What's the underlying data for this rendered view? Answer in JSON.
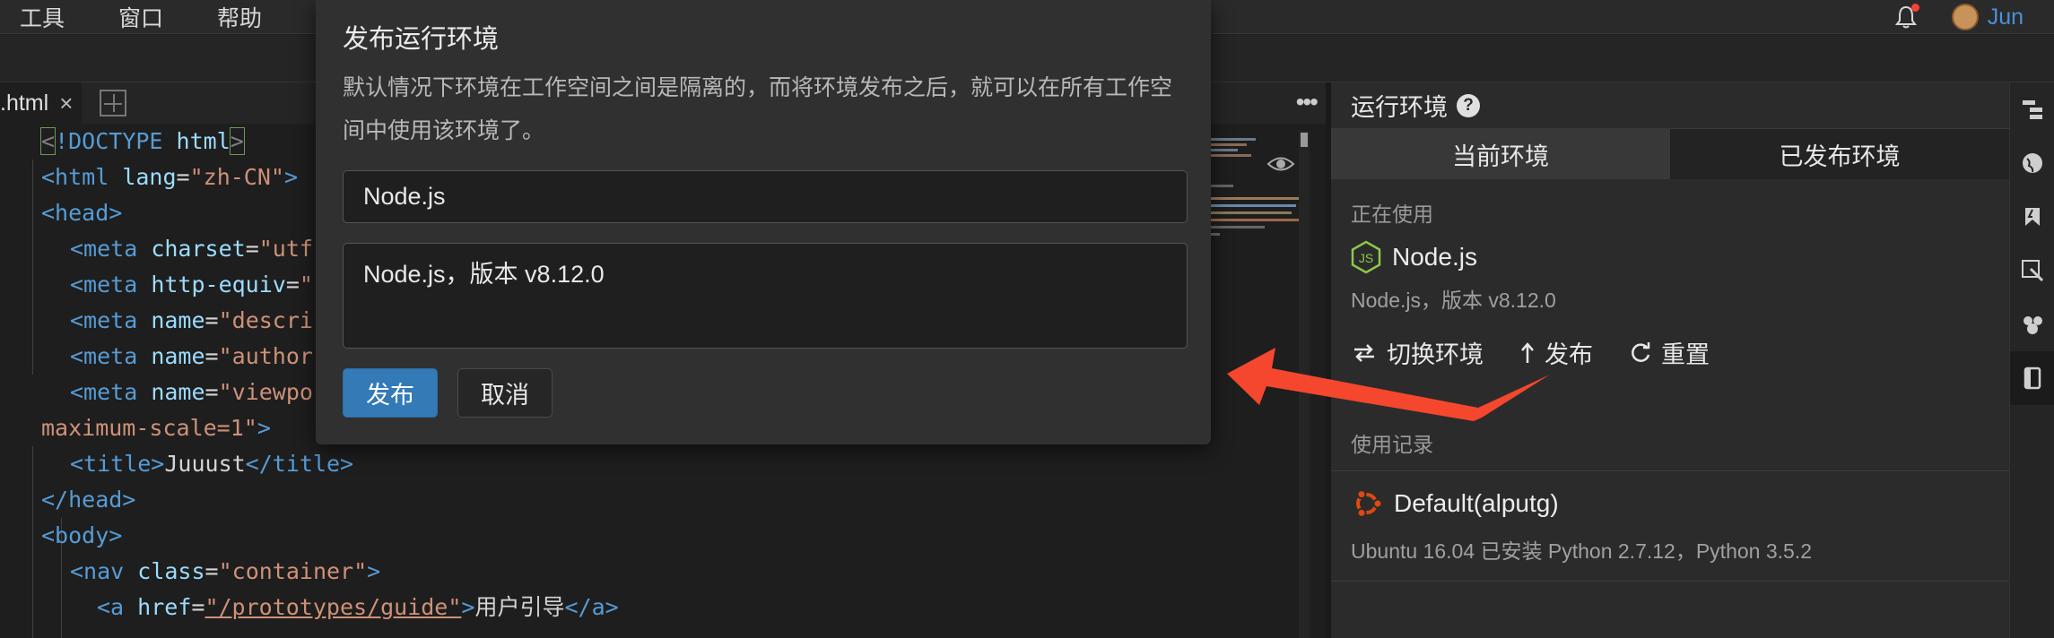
{
  "menubar": {
    "items": [
      "工具",
      "窗口",
      "帮助"
    ],
    "user_name": "Jun"
  },
  "editor": {
    "tab_label": ".html",
    "tab_close": "×",
    "more": "•••",
    "code": {
      "l1_a": "<",
      "l1_b": "!DOCTYPE",
      "l1_c": " html",
      "l1_d": ">",
      "l2_a": "<html",
      "l2_b": " lang",
      "l2_c": "=",
      "l2_d": "\"zh-CN\"",
      "l2_e": ">",
      "l3_a": "<head>",
      "l4_a": "<meta",
      "l4_b": " charset",
      "l4_c": "=",
      "l4_d": "\"utf",
      "l5_a": "<meta",
      "l5_b": " http-equiv",
      "l5_c": "=",
      "l5_d": "\"",
      "l6_a": "<meta",
      "l6_b": " name",
      "l6_c": "=",
      "l6_d": "\"descri",
      "l7_a": "<meta",
      "l7_b": " name",
      "l7_c": "=",
      "l7_d": "\"author",
      "l8_a": "<meta",
      "l8_b": " name",
      "l8_c": "=",
      "l8_d": "\"viewpo",
      "l9_a": "maximum-scale=1\"",
      "l9_b": ">",
      "l10_a": "<title>",
      "l10_b": "Juuust",
      "l10_c": "</title>",
      "l11_a": "</head>",
      "l12_a": "<body>",
      "l13_a": "<nav",
      "l13_b": " class",
      "l13_c": "=",
      "l13_d": "\"container\"",
      "l13_e": ">",
      "l14_a": "<a",
      "l14_b": " href",
      "l14_c": "=",
      "l14_d": "\"/prototypes/guide\"",
      "l14_e": ">",
      "l14_f": "用户引导",
      "l14_g": "</a>"
    }
  },
  "dialog": {
    "title": "发布运行环境",
    "description": "默认情况下环境在工作空间之间是隔离的，而将环境发布之后，就可以在所有工作空间中使用该环境了。",
    "name_value": "Node.js",
    "desc_value": "Node.js，版本 v8.12.0",
    "publish_label": "发布",
    "cancel_label": "取消"
  },
  "panel": {
    "title": "运行环境",
    "tabs": {
      "current": "当前环境",
      "published": "已发布环境"
    },
    "in_use_label": "正在使用",
    "current_env": {
      "name": "Node.js",
      "desc": "Node.js，版本 v8.12.0"
    },
    "actions": {
      "switch": "切换环境",
      "publish": "发布",
      "reset": "重置"
    },
    "history_label": "使用记录",
    "history": [
      {
        "name": "Default(alputg)",
        "desc": "Ubuntu 16.04 已安装 Python 2.7.12，Python 3.5.2"
      }
    ]
  },
  "colors": {
    "accent": "#337ab7",
    "annotation_arrow": "#f4472d",
    "user_link": "#4a90d9"
  }
}
